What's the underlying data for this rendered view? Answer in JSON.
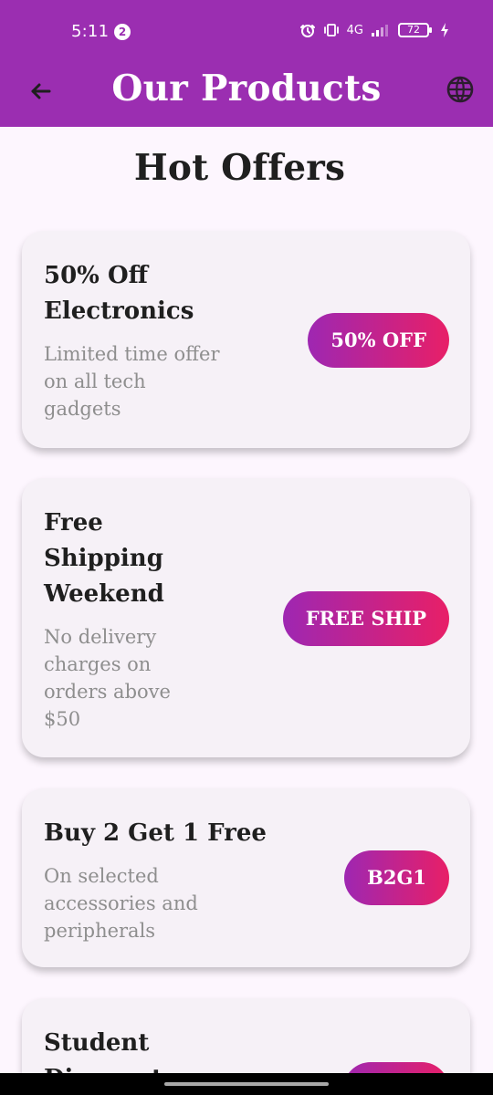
{
  "status_bar": {
    "time": "5:11",
    "notification_count": "2",
    "network": "4G",
    "battery": "72"
  },
  "app_bar": {
    "title": "Our Products",
    "back_icon": "back-arrow-icon",
    "language_icon": "globe-icon"
  },
  "section": {
    "title": "Hot Offers"
  },
  "offers": [
    {
      "title": "50% Off\n  Electronics",
      "description": "Limited time offer\n  on all tech\n  gadgets",
      "badge": "50% OFF"
    },
    {
      "title": "Free\n    Shipping\n    Weekend",
      "description": "No delivery\n    charges on\n    orders above\n  $50",
      "badge": "FREE SHIP"
    },
    {
      "title": "Buy 2 Get 1 Free",
      "description": "On selected\n  accessories and\n  peripherals",
      "badge": "B2G1"
    },
    {
      "title": "Student\n  Discount",
      "description": "",
      "badge": ""
    }
  ],
  "colors": {
    "app_bar": "#9b2eb1",
    "page_background": "#fdf6fe",
    "card_background": "#f6f1f7",
    "badge_gradient_start": "#9e27b2",
    "badge_gradient_end": "#e81f67"
  }
}
